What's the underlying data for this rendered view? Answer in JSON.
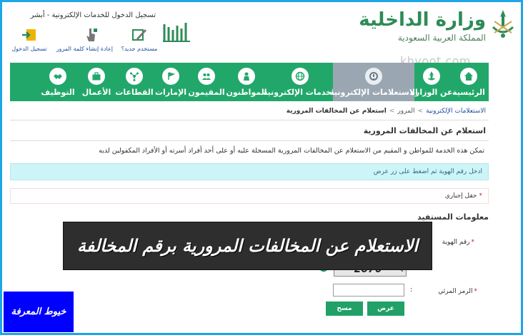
{
  "header": {
    "ministry_name": "وزارة الداخلية",
    "ministry_sub": "المملكة العربية السعودية",
    "absher_title": "تسجيل الدخول للخدمات الإلكترونية - أبشر",
    "links": [
      {
        "label": "مستخدم جديد؟",
        "icon": "edit-icon"
      },
      {
        "label": "إعادة إنشاء كلمة المرور",
        "icon": "pointer-icon"
      },
      {
        "label": "تسجيل الدخول",
        "icon": "login-icon"
      }
    ],
    "watermark": "khyoot.com"
  },
  "nav": {
    "items": [
      {
        "label": "الرئيسية",
        "icon": "home-icon"
      },
      {
        "label": "عن الوزارة",
        "icon": "ministry-icon"
      },
      {
        "label": "الاستعلامات الإلكترونية",
        "icon": "inquiry-icon"
      },
      {
        "label": "الخدمات الإلكترونية",
        "icon": "globe-icon"
      },
      {
        "label": "المواطنون",
        "icon": "citizen-icon"
      },
      {
        "label": "المقيمون",
        "icon": "residents-icon"
      },
      {
        "label": "الإمارات",
        "icon": "emirates-icon"
      },
      {
        "label": "القطاعات",
        "icon": "sectors-icon"
      },
      {
        "label": "الأعمال",
        "icon": "briefcase-icon"
      },
      {
        "label": "التوظيف",
        "icon": "handshake-icon"
      }
    ],
    "colors": {
      "bar": "#22a76a",
      "active": "#9aa7b2"
    }
  },
  "breadcrumb": {
    "link": "الاستعلامات الإلكترونية",
    "sep": ">",
    "middle": "المرور",
    "current": "استعلام عن المخالفات المرورية"
  },
  "page": {
    "title": "استعلام عن المخالفات المرورية",
    "description": "تمكن هذه الخدمة للمواطن و المقيم من الاستعلام عن المخالفات المرورية المسجلة عليه أو على أحد أفراد أسرته أو الأفراد المكفولين لديه",
    "info": "ادخل رقم الهوية ثم اضغط على زر عرض",
    "required_note": "حقل إجباري",
    "section": "معلومات المستفيد",
    "id_label": "رقم الهوية",
    "captcha_value": "2876",
    "code_label": "الرمز المرئي",
    "code_colon": ":",
    "show_button": "عرض",
    "clear_button": "مسح"
  },
  "overlay": {
    "banner": "الاستعلام عن المخالفات المرورية برقم المخالفة",
    "badge": "خيوط المعرفة"
  }
}
